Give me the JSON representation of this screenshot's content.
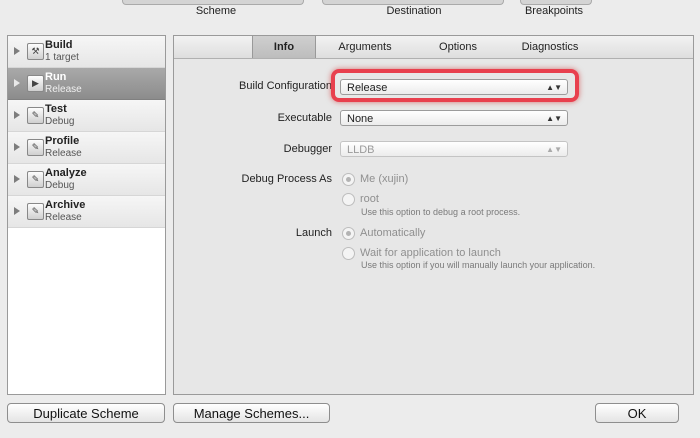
{
  "toolbar": {
    "scheme_label": "Scheme",
    "destination_label": "Destination",
    "breakpoints_label": "Breakpoints"
  },
  "schemes": [
    {
      "name": "Build",
      "sub": "1 target",
      "icon": "hammer-icon",
      "selected": false
    },
    {
      "name": "Run",
      "sub": "Release",
      "icon": "play-icon",
      "selected": true
    },
    {
      "name": "Test",
      "sub": "Debug",
      "icon": "wrench-icon",
      "selected": false
    },
    {
      "name": "Profile",
      "sub": "Release",
      "icon": "wrench-icon",
      "selected": false
    },
    {
      "name": "Analyze",
      "sub": "Debug",
      "icon": "wrench-icon",
      "selected": false
    },
    {
      "name": "Archive",
      "sub": "Release",
      "icon": "wrench-icon",
      "selected": false
    }
  ],
  "tabs": [
    "Info",
    "Arguments",
    "Options",
    "Diagnostics"
  ],
  "active_tab": "Info",
  "form": {
    "build_config_label": "Build Configuration",
    "build_config_value": "Release",
    "executable_label": "Executable",
    "executable_value": "None",
    "debugger_label": "Debugger",
    "debugger_value": "LLDB",
    "debug_process_label": "Debug Process As",
    "debug_process_me": "Me (xujin)",
    "debug_process_root": "root",
    "debug_process_root_hint": "Use this option to debug a root process.",
    "launch_label": "Launch",
    "launch_auto": "Automatically",
    "launch_wait": "Wait for application to launch",
    "launch_wait_hint": "Use this option if you will manually launch your application."
  },
  "buttons": {
    "duplicate": "Duplicate Scheme",
    "manage": "Manage Schemes...",
    "ok": "OK"
  },
  "colors": {
    "highlight": "#e8404e",
    "selected_row": "#9a9a9a"
  }
}
